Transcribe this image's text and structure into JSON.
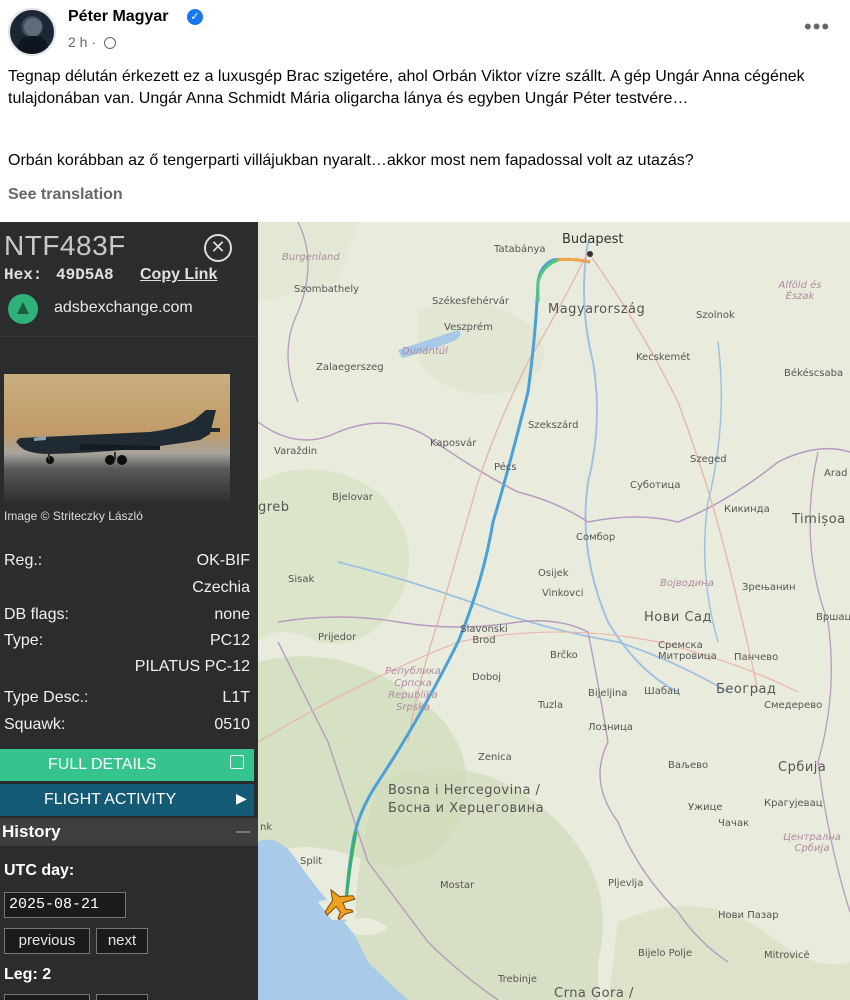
{
  "post": {
    "author": "Péter Magyar",
    "timestamp": "2 h ·",
    "paragraph1": "Tegnap délután érkezett ez a luxusgép Brac szigetére, ahol Orbán Viktor vízre szállt. A gép Ungár Anna cégének tulajdonában van. Ungár Anna Schmidt Mária oligarcha lánya és egyben Ungár Péter testvére…",
    "paragraph2": "Orbán korábban az ő tengerparti villájukban nyaralt…akkor most nem fapadossal volt az utazás?",
    "see_translation": "See translation",
    "more_label": "•••"
  },
  "panel": {
    "callsign": "NTF483F",
    "hex_label": "Hex:",
    "hex_value": "49D5A8",
    "copy_link": "Copy Link",
    "site": "adsbexchange.com",
    "image_credit": "Image © Striteczky László",
    "reg_label": "Reg.:",
    "reg_value": "OK-BIF",
    "country": "Czechia",
    "db_flags_label": "DB flags:",
    "db_flags_value": "none",
    "type_label": "Type:",
    "type_value": "PC12",
    "type_name": "PILATUS PC-12",
    "type_desc_label": "Type Desc.:",
    "type_desc_value": "L1T",
    "squawk_label": "Squawk:",
    "squawk_value": "0510",
    "full_details": "FULL DETAILS",
    "flight_activity": "FLIGHT ACTIVITY",
    "history": "History",
    "utc_day_label": "UTC day:",
    "utc_day_value": "2025-08-21",
    "previous": "previous",
    "next": "next",
    "leg": "Leg: 2"
  },
  "map": {
    "labels": {
      "budapest": "Budapest",
      "tatabanya": "Tatabánya",
      "burgenland": "Burgenland",
      "szombathely": "Szombathely",
      "szekesfehervar": "Székesfehérvár",
      "magyarorszag": "Magyarország",
      "szolnok": "Szolnok",
      "alfold": "Alföld és Észak",
      "veszprem": "Veszprém",
      "dunantul": "Dunántúl",
      "kecskemet": "Kecskemét",
      "zalaegerszeg": "Zalaegerszeg",
      "bekescsaba": "Békéscsaba",
      "szekszard": "Szekszárd",
      "kaposvar": "Kaposvár",
      "varazdin": "Varaždin",
      "pecs": "Pécs",
      "szeged": "Szeged",
      "subotica": "Суботица",
      "arad": "Arad",
      "bjelovar": "Bjelovar",
      "kikinda": "Кикинда",
      "timisoara": "Timișoa",
      "zagreb": "greb",
      "sombor": "Сомбор",
      "sisak": "Sisak",
      "osijek": "Osijek",
      "vinkovci": "Vinkovci",
      "vojvodina": "Војводина",
      "zrenjanin": "Зрењанин",
      "novi_sad": "Нови Сад",
      "vrsac": "Вршац",
      "prijedor": "Prijedor",
      "slavonski_brod": "Slavonski Brod",
      "brcko": "Brčko",
      "sremska": "Сремска Митровица",
      "pancevo": "Панчево",
      "republika_srpska": "Република Српска Republika Srpska",
      "doboj": "Doboj",
      "bijeljina": "Bijeljina",
      "sabac": "Шабац",
      "beograd": "Београд",
      "smederevo": "Смедерево",
      "tuzla": "Tuzla",
      "loznica": "Лозница",
      "zenica": "Zenica",
      "valjevo": "Ваљево",
      "srbija": "Србија",
      "bih": "Bosna i Hercegovina / Босна и Херцеговина",
      "uzice": "Ужице",
      "kragujevac": "Крагујевац",
      "cacak": "Чачак",
      "centralna": "Централна Србија",
      "split": "Split",
      "mostar": "Mostar",
      "pljevlja": "Pljevlja",
      "novi_pazar": "Нови Пазар",
      "bijelo_polje": "Bijelo Polje",
      "mitrovice": "Mitrovicë",
      "trebinje": "Trebinje",
      "crna_gora": "Crna Gora /",
      "nk": "nk"
    }
  }
}
